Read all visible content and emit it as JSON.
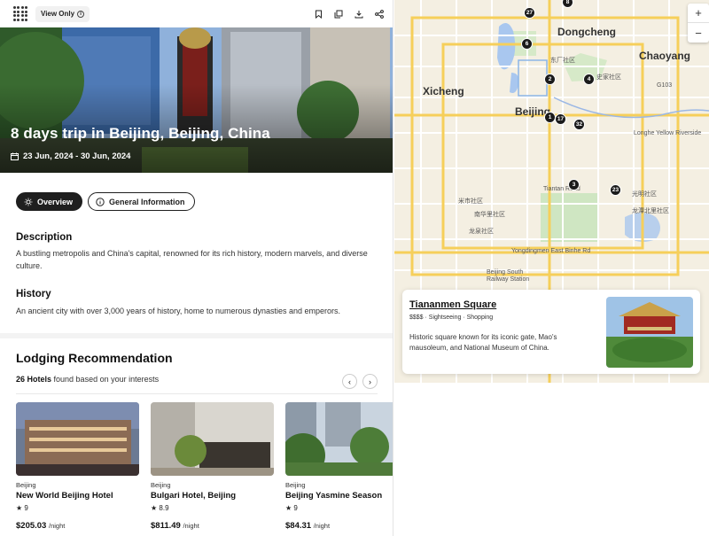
{
  "topbar": {
    "view_only_label": "View Only",
    "icons": [
      "bookmark-icon",
      "copy-icon",
      "download-icon",
      "share-icon"
    ]
  },
  "trip": {
    "title": "8 days trip in Beijing, Beijing, China",
    "dates": "23 Jun, 2024 - 30 Jun, 2024"
  },
  "tabs": [
    {
      "label": "Overview",
      "active": true
    },
    {
      "label": "General Information",
      "active": false
    }
  ],
  "description": {
    "heading": "Description",
    "text": "A bustling metropolis and China's capital, renowned for its rich history, modern marvels, and diverse culture."
  },
  "history": {
    "heading": "History",
    "text": "An ancient city with over 3,000 years of history, home to numerous dynasties and emperors."
  },
  "lodging": {
    "title": "Lodging Recommendation",
    "count": "26 Hotels",
    "count_suffix": " found based on your interests",
    "hotels": [
      {
        "city": "Beijing",
        "name": "New World Beijing Hotel",
        "rating": "9",
        "price": "$205.03",
        "per": "/night"
      },
      {
        "city": "Beijing",
        "name": "Bulgari Hotel, Beijing",
        "rating": "8.9",
        "price": "$811.49",
        "per": "/night"
      },
      {
        "city": "Beijing",
        "name": "Beijing Yasmine Season",
        "rating": "9",
        "price": "$84.31",
        "per": "/night"
      }
    ]
  },
  "map": {
    "labels": {
      "dongcheng": "Dongcheng",
      "chaoyang": "Chaoyang",
      "xicheng": "Xicheng",
      "beijing": "Beijing",
      "dongcheng_cn": "东厂社区",
      "shijia": "史家社区",
      "guanghua": "光明社区",
      "longtan": "龙潭北里社区",
      "mishi": "米市社区",
      "nanhua": "南华里社区",
      "longquan": "龙泉社区",
      "station": "Beijing South Railway Station",
      "yongdingmen": "Yongdingmen East Binhe Rd",
      "tiantan": "Tiantan Road",
      "longhe": "Longhe Yellow Riverside",
      "g103": "G103"
    },
    "pins": [
      "27",
      "8",
      "6",
      "2",
      "4",
      "1",
      "17",
      "32",
      "3",
      "23"
    ],
    "zoom_in": "+",
    "zoom_out": "−"
  },
  "place": {
    "name": "Tiananmen Square",
    "meta": "$$$$ · Sightseeing · Shopping",
    "description": "Historic square known for its iconic gate, Mao's mausoleum, and National Museum of China."
  }
}
